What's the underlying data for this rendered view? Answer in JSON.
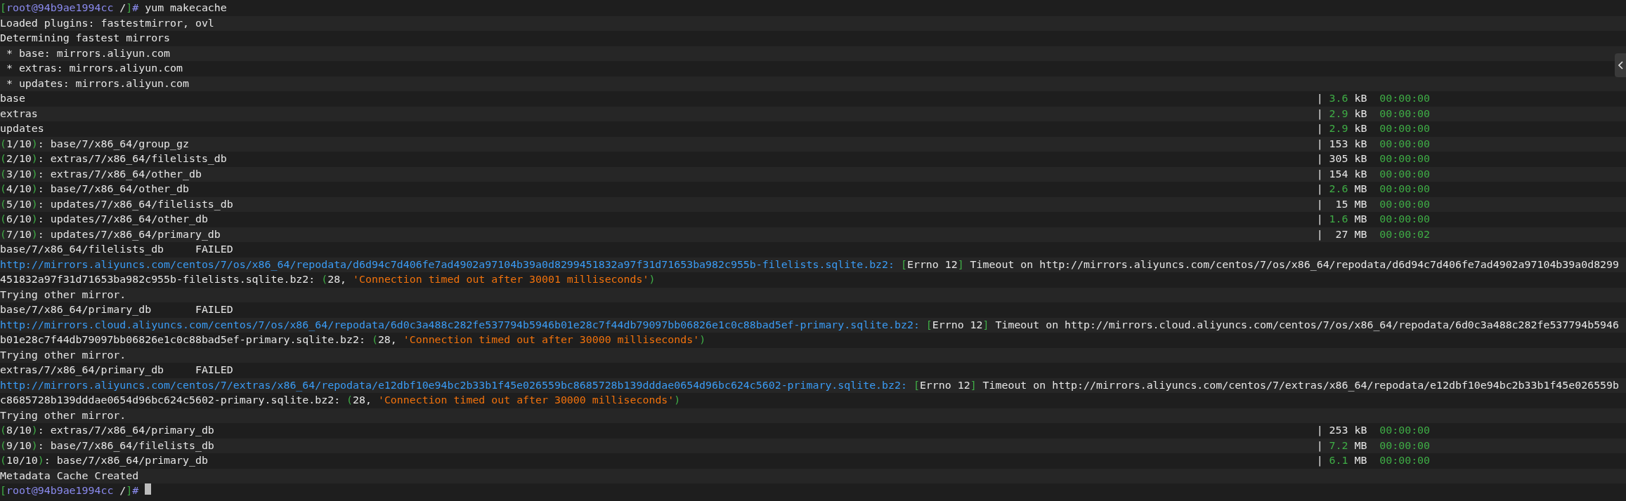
{
  "terminal": {
    "lines": [
      {
        "segments": [
          {
            "text": "[",
            "kind": "green"
          },
          {
            "text": "root@94b9ae1994cc",
            "kind": "prompt"
          },
          {
            "text": " /",
            "kind": "plain"
          },
          {
            "text": "]",
            "kind": "green"
          },
          {
            "text": "# ",
            "kind": "prompt"
          },
          {
            "text": "yum makecache",
            "kind": "plain"
          }
        ]
      },
      {
        "segments": [
          {
            "text": "Loaded plugins: fastestmirror, ovl",
            "kind": "plain"
          }
        ]
      },
      {
        "segments": [
          {
            "text": "Determining fastest mirrors",
            "kind": "plain"
          }
        ]
      },
      {
        "segments": [
          {
            "text": " * base: mirrors.aliyun.com",
            "kind": "plain"
          }
        ]
      },
      {
        "segments": [
          {
            "text": " * extras: mirrors.aliyun.com",
            "kind": "plain"
          }
        ]
      },
      {
        "segments": [
          {
            "text": " * updates: mirrors.aliyun.com",
            "kind": "plain"
          }
        ]
      },
      {
        "segments": [
          {
            "text": "base",
            "kind": "plain"
          }
        ],
        "right": [
          {
            "text": "| ",
            "kind": "plain"
          },
          {
            "text": "3.6",
            "kind": "green"
          },
          {
            "text": " kB  ",
            "kind": "plain"
          },
          {
            "text": "00:00:00",
            "kind": "green"
          }
        ]
      },
      {
        "segments": [
          {
            "text": "extras",
            "kind": "plain"
          }
        ],
        "right": [
          {
            "text": "| ",
            "kind": "plain"
          },
          {
            "text": "2.9",
            "kind": "green"
          },
          {
            "text": " kB  ",
            "kind": "plain"
          },
          {
            "text": "00:00:00",
            "kind": "green"
          }
        ]
      },
      {
        "segments": [
          {
            "text": "updates",
            "kind": "plain"
          }
        ],
        "right": [
          {
            "text": "| ",
            "kind": "plain"
          },
          {
            "text": "2.9",
            "kind": "green"
          },
          {
            "text": " kB  ",
            "kind": "plain"
          },
          {
            "text": "00:00:00",
            "kind": "green"
          }
        ]
      },
      {
        "segments": [
          {
            "text": "(",
            "kind": "green"
          },
          {
            "text": "1/10",
            "kind": "plain"
          },
          {
            "text": ")",
            "kind": "green"
          },
          {
            "text": ": base/7/x86_64/group_gz",
            "kind": "plain"
          }
        ],
        "right": [
          {
            "text": "| 153 kB  ",
            "kind": "plain"
          },
          {
            "text": "00:00:00",
            "kind": "green"
          }
        ]
      },
      {
        "segments": [
          {
            "text": "(",
            "kind": "green"
          },
          {
            "text": "2/10",
            "kind": "plain"
          },
          {
            "text": ")",
            "kind": "green"
          },
          {
            "text": ": extras/7/x86_64/filelists_db",
            "kind": "plain"
          }
        ],
        "right": [
          {
            "text": "| 305 kB  ",
            "kind": "plain"
          },
          {
            "text": "00:00:00",
            "kind": "green"
          }
        ]
      },
      {
        "segments": [
          {
            "text": "(",
            "kind": "green"
          },
          {
            "text": "3/10",
            "kind": "plain"
          },
          {
            "text": ")",
            "kind": "green"
          },
          {
            "text": ": extras/7/x86_64/other_db",
            "kind": "plain"
          }
        ],
        "right": [
          {
            "text": "| 154 kB  ",
            "kind": "plain"
          },
          {
            "text": "00:00:00",
            "kind": "green"
          }
        ]
      },
      {
        "segments": [
          {
            "text": "(",
            "kind": "green"
          },
          {
            "text": "4/10",
            "kind": "plain"
          },
          {
            "text": ")",
            "kind": "green"
          },
          {
            "text": ": base/7/x86_64/other_db",
            "kind": "plain"
          }
        ],
        "right": [
          {
            "text": "| ",
            "kind": "plain"
          },
          {
            "text": "2.6",
            "kind": "green"
          },
          {
            "text": " MB  ",
            "kind": "plain"
          },
          {
            "text": "00:00:00",
            "kind": "green"
          }
        ]
      },
      {
        "segments": [
          {
            "text": "(",
            "kind": "green"
          },
          {
            "text": "5/10",
            "kind": "plain"
          },
          {
            "text": ")",
            "kind": "green"
          },
          {
            "text": ": updates/7/x86_64/filelists_db",
            "kind": "plain"
          }
        ],
        "right": [
          {
            "text": "|  15 MB  ",
            "kind": "plain"
          },
          {
            "text": "00:00:00",
            "kind": "green"
          }
        ]
      },
      {
        "segments": [
          {
            "text": "(",
            "kind": "green"
          },
          {
            "text": "6/10",
            "kind": "plain"
          },
          {
            "text": ")",
            "kind": "green"
          },
          {
            "text": ": updates/7/x86_64/other_db",
            "kind": "plain"
          }
        ],
        "right": [
          {
            "text": "| ",
            "kind": "plain"
          },
          {
            "text": "1.6",
            "kind": "green"
          },
          {
            "text": " MB  ",
            "kind": "plain"
          },
          {
            "text": "00:00:00",
            "kind": "green"
          }
        ]
      },
      {
        "segments": [
          {
            "text": "(",
            "kind": "green"
          },
          {
            "text": "7/10",
            "kind": "plain"
          },
          {
            "text": ")",
            "kind": "green"
          },
          {
            "text": ": updates/7/x86_64/primary_db",
            "kind": "plain"
          }
        ],
        "right": [
          {
            "text": "|  27 MB  ",
            "kind": "plain"
          },
          {
            "text": "00:00:02",
            "kind": "green"
          }
        ]
      },
      {
        "segments": [
          {
            "text": "base/7/x86_64/filelists_db     FAILED",
            "kind": "plain"
          }
        ]
      },
      {
        "segments": [
          {
            "text": "http://mirrors.aliyuncs.com/centos/7/os/x86_64/repodata/d6d94c7d406fe7ad4902a97104b39a0d8299451832a97f31d71653ba982c955b-filelists.sqlite.bz2: ",
            "kind": "url"
          },
          {
            "text": "[",
            "kind": "green"
          },
          {
            "text": "Errno 12",
            "kind": "plain"
          },
          {
            "text": "]",
            "kind": "green"
          },
          {
            "text": " Timeout on http://mirrors.aliyuncs.com/centos/7/os/x86_64/repodata/d6d94c7d406fe7ad4902a97104b39a0d8299",
            "kind": "plain"
          }
        ]
      },
      {
        "segments": [
          {
            "text": "451832a97f31d71653ba982c955b-filelists.sqlite.bz2: ",
            "kind": "plain"
          },
          {
            "text": "(",
            "kind": "green"
          },
          {
            "text": "28, ",
            "kind": "plain"
          },
          {
            "text": "'Connection timed out after 30001 milliseconds'",
            "kind": "orange"
          },
          {
            "text": ")",
            "kind": "green"
          }
        ]
      },
      {
        "segments": [
          {
            "text": "Trying other mirror.",
            "kind": "plain"
          }
        ]
      },
      {
        "segments": [
          {
            "text": "base/7/x86_64/primary_db       FAILED",
            "kind": "plain"
          }
        ]
      },
      {
        "segments": [
          {
            "text": "http://mirrors.cloud.aliyuncs.com/centos/7/os/x86_64/repodata/6d0c3a488c282fe537794b5946b01e28c7f44db79097bb06826e1c0c88bad5ef-primary.sqlite.bz2: ",
            "kind": "url"
          },
          {
            "text": "[",
            "kind": "green"
          },
          {
            "text": "Errno 12",
            "kind": "plain"
          },
          {
            "text": "]",
            "kind": "green"
          },
          {
            "text": " Timeout on http://mirrors.cloud.aliyuncs.com/centos/7/os/x86_64/repodata/6d0c3a488c282fe537794b5946",
            "kind": "plain"
          }
        ]
      },
      {
        "segments": [
          {
            "text": "b01e28c7f44db79097bb06826e1c0c88bad5ef-primary.sqlite.bz2: ",
            "kind": "plain"
          },
          {
            "text": "(",
            "kind": "green"
          },
          {
            "text": "28, ",
            "kind": "plain"
          },
          {
            "text": "'Connection timed out after 30000 milliseconds'",
            "kind": "orange"
          },
          {
            "text": ")",
            "kind": "green"
          }
        ]
      },
      {
        "segments": [
          {
            "text": "Trying other mirror.",
            "kind": "plain"
          }
        ]
      },
      {
        "segments": [
          {
            "text": "extras/7/x86_64/primary_db     FAILED",
            "kind": "plain"
          }
        ]
      },
      {
        "segments": [
          {
            "text": "http://mirrors.aliyuncs.com/centos/7/extras/x86_64/repodata/e12dbf10e94bc2b33b1f45e026559bc8685728b139dddae0654d96bc624c5602-primary.sqlite.bz2: ",
            "kind": "url"
          },
          {
            "text": "[",
            "kind": "green"
          },
          {
            "text": "Errno 12",
            "kind": "plain"
          },
          {
            "text": "]",
            "kind": "green"
          },
          {
            "text": " Timeout on http://mirrors.aliyuncs.com/centos/7/extras/x86_64/repodata/e12dbf10e94bc2b33b1f45e026559b",
            "kind": "plain"
          }
        ]
      },
      {
        "segments": [
          {
            "text": "c8685728b139dddae0654d96bc624c5602-primary.sqlite.bz2: ",
            "kind": "plain"
          },
          {
            "text": "(",
            "kind": "green"
          },
          {
            "text": "28, ",
            "kind": "plain"
          },
          {
            "text": "'Connection timed out after 30000 milliseconds'",
            "kind": "orange"
          },
          {
            "text": ")",
            "kind": "green"
          }
        ]
      },
      {
        "segments": [
          {
            "text": "Trying other mirror.",
            "kind": "plain"
          }
        ]
      },
      {
        "segments": [
          {
            "text": "(",
            "kind": "green"
          },
          {
            "text": "8/10",
            "kind": "plain"
          },
          {
            "text": ")",
            "kind": "green"
          },
          {
            "text": ": extras/7/x86_64/primary_db",
            "kind": "plain"
          }
        ],
        "right": [
          {
            "text": "| 253 kB  ",
            "kind": "plain"
          },
          {
            "text": "00:00:00",
            "kind": "green"
          }
        ]
      },
      {
        "segments": [
          {
            "text": "(",
            "kind": "green"
          },
          {
            "text": "9/10",
            "kind": "plain"
          },
          {
            "text": ")",
            "kind": "green"
          },
          {
            "text": ": base/7/x86_64/filelists_db",
            "kind": "plain"
          }
        ],
        "right": [
          {
            "text": "| ",
            "kind": "plain"
          },
          {
            "text": "7.2",
            "kind": "green"
          },
          {
            "text": " MB  ",
            "kind": "plain"
          },
          {
            "text": "00:00:00",
            "kind": "green"
          }
        ]
      },
      {
        "segments": [
          {
            "text": "(",
            "kind": "green"
          },
          {
            "text": "10/10",
            "kind": "plain"
          },
          {
            "text": ")",
            "kind": "green"
          },
          {
            "text": ": base/7/x86_64/primary_db",
            "kind": "plain"
          }
        ],
        "right": [
          {
            "text": "| ",
            "kind": "plain"
          },
          {
            "text": "6.1",
            "kind": "green"
          },
          {
            "text": " MB  ",
            "kind": "plain"
          },
          {
            "text": "00:00:00",
            "kind": "green"
          }
        ]
      },
      {
        "segments": [
          {
            "text": "Metadata Cache Created",
            "kind": "plain"
          }
        ]
      },
      {
        "segments": [
          {
            "text": "[",
            "kind": "green"
          },
          {
            "text": "root@94b9ae1994cc",
            "kind": "prompt"
          },
          {
            "text": " /",
            "kind": "plain"
          },
          {
            "text": "]",
            "kind": "green"
          },
          {
            "text": "# ",
            "kind": "prompt"
          }
        ],
        "cursor": true
      }
    ]
  }
}
